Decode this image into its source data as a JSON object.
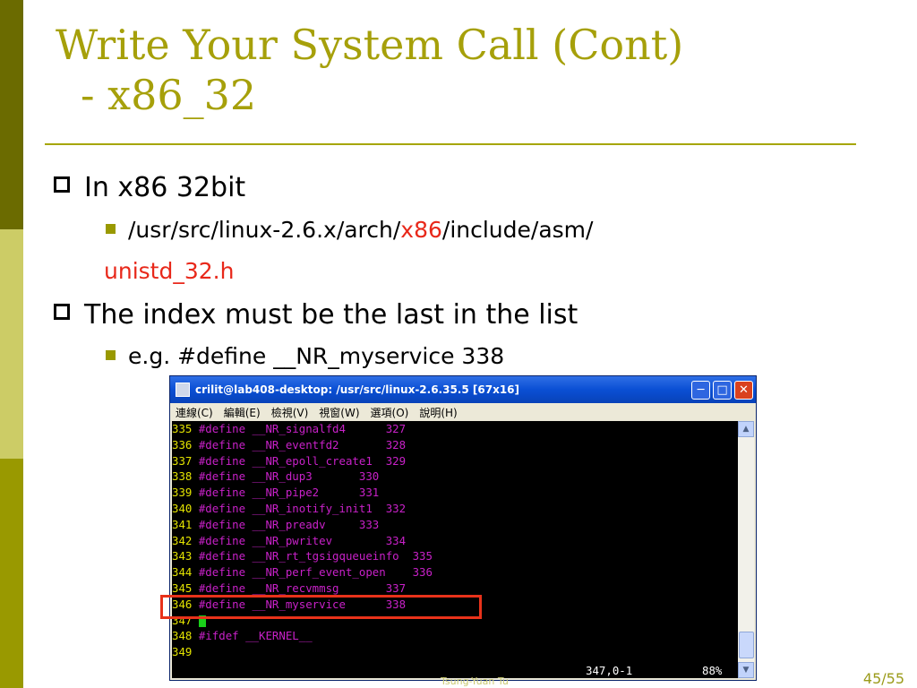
{
  "slide": {
    "title_line1": "Write Your System Call (Cont)",
    "title_line2": "- x86_32",
    "bullets": [
      {
        "text": "In x86 32bit"
      },
      {
        "text": "The index must be the last in the list"
      }
    ],
    "sub1_prefix": "/usr/src/linux-2.6.x/arch/",
    "sub1_highlight": "x86",
    "sub1_suffix": "/include/asm/",
    "sub1_continuation": "unistd_32.h",
    "sub2": "e.g. #define __NR_myservice 338",
    "author": "Tsung-Yuan Tu",
    "page": "45/55"
  },
  "terminal": {
    "title": "crilit@lab408-desktop: /usr/src/linux-2.6.35.5 [67x16]",
    "menu": [
      "連線(C)",
      "編輯(E)",
      "檢視(V)",
      "視窗(W)",
      "選項(O)",
      "說明(H)"
    ],
    "lines": [
      {
        "num": "335",
        "code": " #define __NR_signalfd4      327"
      },
      {
        "num": "336",
        "code": " #define __NR_eventfd2       328"
      },
      {
        "num": "337",
        "code": " #define __NR_epoll_create1  329"
      },
      {
        "num": "338",
        "code": " #define __NR_dup3       330"
      },
      {
        "num": "339",
        "code": " #define __NR_pipe2      331"
      },
      {
        "num": "340",
        "code": " #define __NR_inotify_init1  332"
      },
      {
        "num": "341",
        "code": " #define __NR_preadv     333"
      },
      {
        "num": "342",
        "code": " #define __NR_pwritev        334"
      },
      {
        "num": "343",
        "code": " #define __NR_rt_tgsigqueueinfo  335"
      },
      {
        "num": "344",
        "code": " #define __NR_perf_event_open    336"
      },
      {
        "num": "345",
        "code": " #define __NR_recvmmsg       337"
      },
      {
        "num": "346",
        "code": " #define __NR_myservice      338"
      },
      {
        "num": "347",
        "code": " ",
        "cursor": true
      },
      {
        "num": "348",
        "code": " #ifdef __KERNEL__"
      },
      {
        "num": "349",
        "code": ""
      }
    ],
    "status_pos": "347,0-1",
    "status_pct": "88%"
  },
  "colors": {
    "title": "#a6a00a",
    "accent_red": "#e8281a",
    "bar_dark": "#6b6b00",
    "bar_light": "#cccc66",
    "bar_mid": "#999900"
  },
  "icons": [
    "minimize-icon",
    "maximize-icon",
    "close-icon",
    "scroll-up-icon",
    "scroll-down-icon"
  ]
}
